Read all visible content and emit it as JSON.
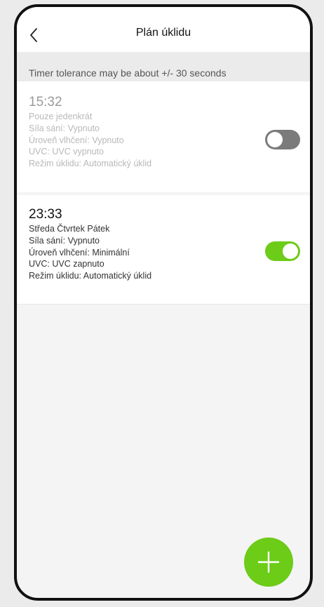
{
  "header": {
    "title": "Plán úklidu",
    "back_icon": "chevron-left-icon"
  },
  "notice": "Timer tolerance may be about +/- 30 seconds",
  "schedules": [
    {
      "time": "15:32",
      "details": [
        "Pouze jedenkrát",
        "Síla sání: Vypnuto",
        "Úroveň vlhčení: Vypnuto",
        "UVC: UVC vypnuto",
        "Režim úklidu: Automatický úklid"
      ],
      "enabled": false
    },
    {
      "time": "23:33",
      "details": [
        "Středa Čtvrtek Pátek",
        "Síla sání: Vypnuto",
        "Úroveň vlhčení: Minimální",
        "UVC: UVC zapnuto",
        "Režim úklidu: Automatický úklid"
      ],
      "enabled": true
    }
  ],
  "fab": {
    "icon": "plus-icon"
  },
  "colors": {
    "accent": "#6ccc18",
    "toggle_off": "#7b7b7b",
    "background": "#f4f4f4"
  }
}
